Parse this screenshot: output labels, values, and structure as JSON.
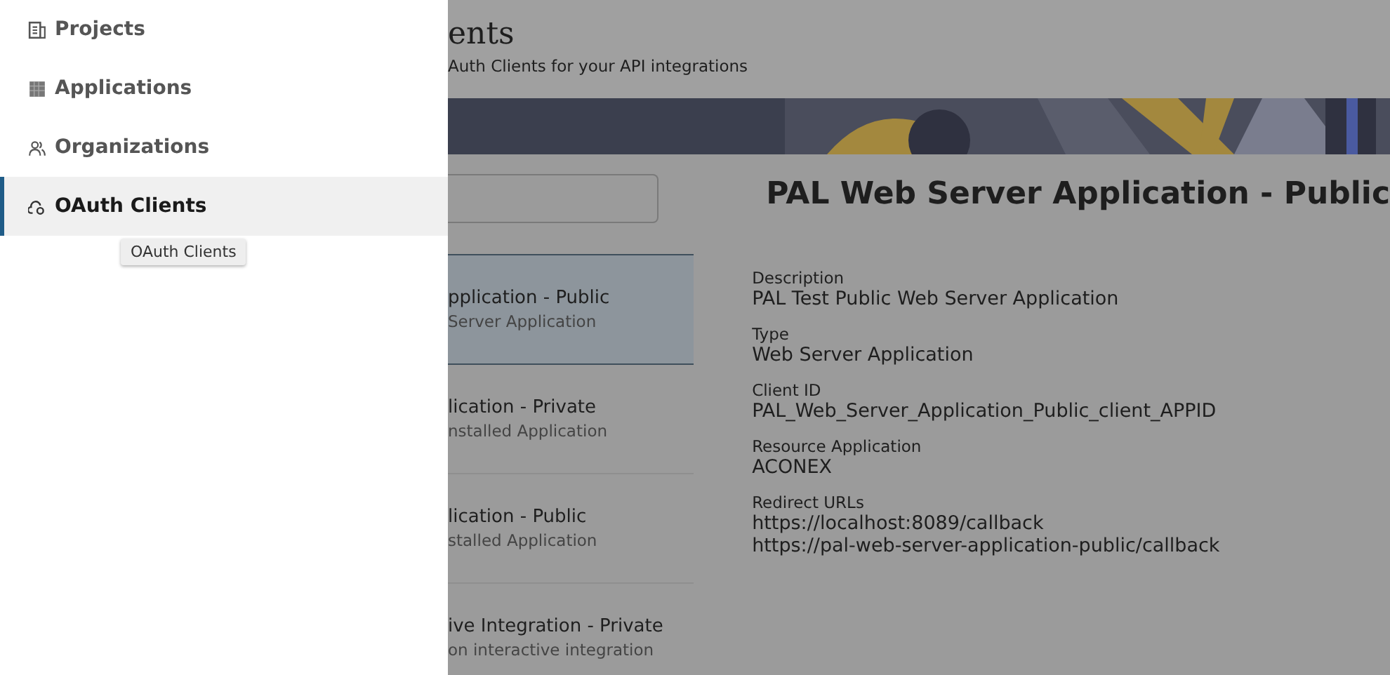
{
  "drawer": {
    "items": [
      {
        "label": "Projects",
        "selected": false
      },
      {
        "label": "Applications",
        "selected": false
      },
      {
        "label": "Organizations",
        "selected": false
      },
      {
        "label": "OAuth Clients",
        "selected": true
      }
    ],
    "tooltip": "OAuth Clients"
  },
  "header": {
    "title": "ents",
    "subtitle": "Auth Clients for your API integrations"
  },
  "clients": [
    {
      "name": "pplication - Public",
      "type": "Server Application",
      "selected": true
    },
    {
      "name": "lication - Private",
      "type": "nstalled Application",
      "selected": false
    },
    {
      "name": "lication - Public",
      "type": "stalled Application",
      "selected": false
    },
    {
      "name": "ive Integration - Private",
      "type": "on interactive integration",
      "selected": false
    }
  ],
  "detail": {
    "title": "PAL Web Server Application - Public",
    "fields": [
      {
        "label": "Description",
        "values": [
          "PAL Test Public Web Server Application"
        ]
      },
      {
        "label": "Type",
        "values": [
          "Web Server Application"
        ]
      },
      {
        "label": "Client ID",
        "values": [
          "PAL_Web_Server_Application_Public_client_APPID"
        ]
      },
      {
        "label": "Resource Application",
        "values": [
          "ACONEX"
        ]
      },
      {
        "label": "Redirect URLs",
        "values": [
          "https://localhost:8089/callback",
          "https://pal-web-server-application-public/callback"
        ]
      }
    ]
  }
}
